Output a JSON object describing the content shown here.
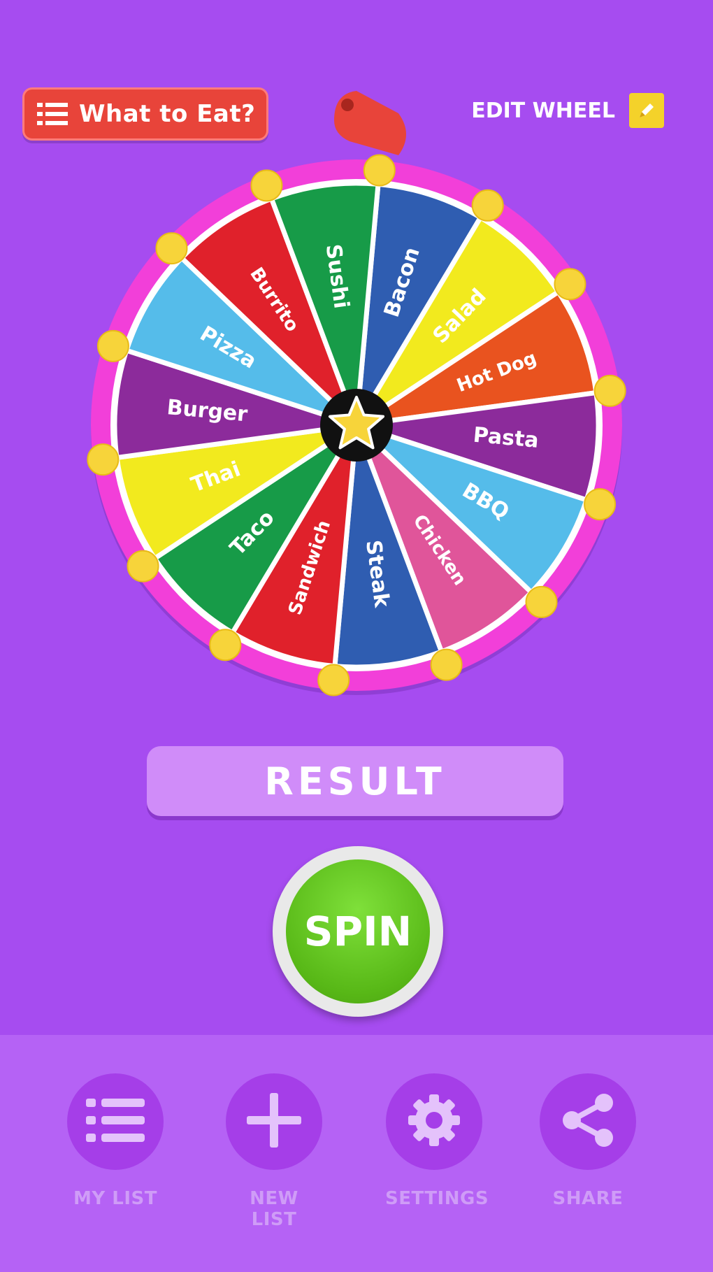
{
  "header": {
    "title": "What to Eat?",
    "title_icon": "list-icon",
    "edit_label": "EDIT WHEEL",
    "edit_icon": "pencil-icon"
  },
  "wheel": {
    "segments": [
      {
        "label": "Bacon",
        "color": "#2f5db1"
      },
      {
        "label": "Salad",
        "color": "#f2ea1e"
      },
      {
        "label": "Hot Dog",
        "color": "#e9531f"
      },
      {
        "label": "Pasta",
        "color": "#8c2b9b"
      },
      {
        "label": "BBQ",
        "color": "#55bcea"
      },
      {
        "label": "Chicken",
        "color": "#e0559a"
      },
      {
        "label": "Steak",
        "color": "#2f5db1"
      },
      {
        "label": "Sandwich",
        "color": "#e0212b"
      },
      {
        "label": "Taco",
        "color": "#179b48"
      },
      {
        "label": "Thai",
        "color": "#f2ea1e"
      },
      {
        "label": "Burger",
        "color": "#8c2b9b"
      },
      {
        "label": "Pizza",
        "color": "#55bcea"
      },
      {
        "label": "Burrito",
        "color": "#e0212b"
      },
      {
        "label": "Sushi",
        "color": "#179b48"
      }
    ],
    "rim_color": "#f23fd9",
    "peg_color": "#f7d43a",
    "pointer_color": "#e8443a",
    "center_icon": "star-icon"
  },
  "result": {
    "label": "RESULT"
  },
  "spin": {
    "label": "SPIN"
  },
  "nav": [
    {
      "label": "MY LIST",
      "icon": "list-icon"
    },
    {
      "label": "NEW LIST",
      "icon": "plus-icon"
    },
    {
      "label": "SETTINGS",
      "icon": "gear-icon"
    },
    {
      "label": "SHARE",
      "icon": "share-icon"
    }
  ]
}
